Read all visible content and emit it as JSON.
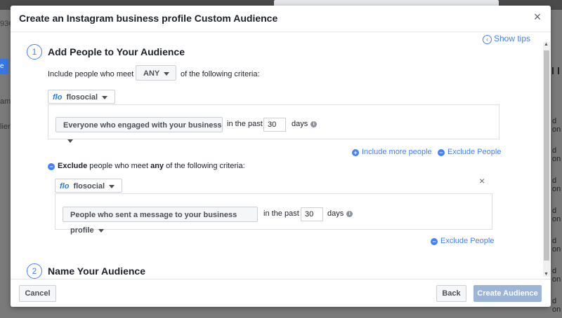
{
  "background": {
    "left_number": "93€",
    "left_button": "e",
    "left_texts": [
      "ame",
      "lience"
    ],
    "right_texts": [
      "d on",
      "d on",
      "d on",
      "d on",
      "d on",
      "d on",
      "d on"
    ]
  },
  "dialog": {
    "title": "Create an Instagram business profile Custom Audience",
    "close_glyph": "×",
    "show_tips": "Show tips"
  },
  "step1": {
    "number": "1",
    "title": "Add People to Your Audience",
    "include_prefix": "Include people who meet",
    "match_value": "ANY",
    "include_suffix": "of the following criteria:",
    "source": {
      "logo": "flo",
      "name": "flosocial"
    },
    "rule": {
      "event": "Everyone who engaged with your business",
      "in_past": "in the past",
      "days_value": "30",
      "days_label": "days"
    },
    "include_more": "Include more people",
    "exclude_people": "Exclude People"
  },
  "exclude": {
    "label_bold": "Exclude",
    "label_mid": "people who meet",
    "label_any": "any",
    "label_suffix": "of the following criteria:",
    "close_glyph": "×",
    "source": {
      "logo": "flo",
      "name": "flosocial"
    },
    "rule": {
      "event": "People who sent a message to your business profile",
      "in_past": "in the past",
      "days_value": "30",
      "days_label": "days"
    },
    "exclude_people": "Exclude People"
  },
  "step2": {
    "number": "2",
    "title": "Name Your Audience"
  },
  "footer": {
    "cancel": "Cancel",
    "back": "Back",
    "create": "Create Audience"
  },
  "colors": {
    "accent": "#4080ff",
    "primary_disabled": "#9cb4d8"
  }
}
